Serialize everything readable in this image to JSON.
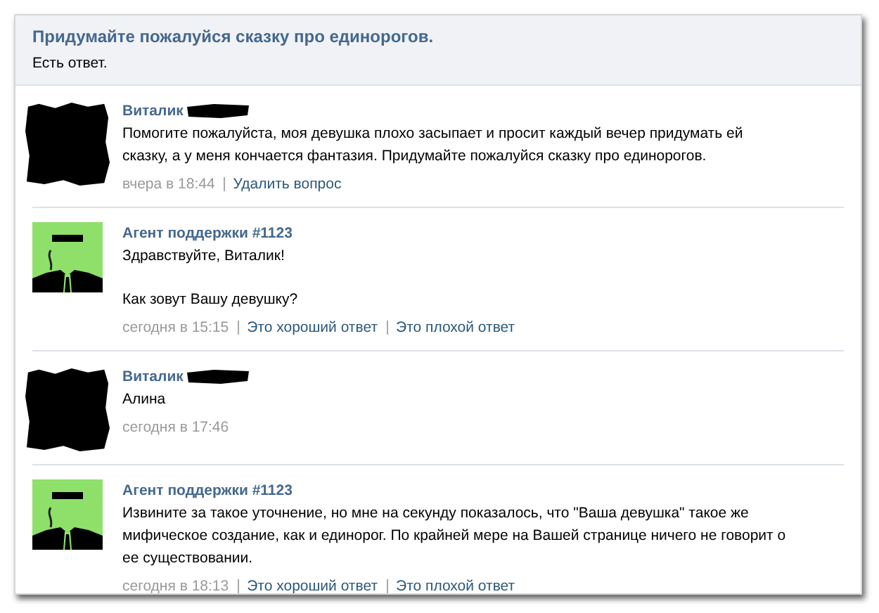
{
  "question": {
    "title": "Придумайте пожалуйся сказку про единорогов.",
    "status": "Есть ответ."
  },
  "messages": [
    {
      "kind": "user",
      "author": "Виталик",
      "paragraphs": [
        "Помогите пожалуйста, моя девушка плохо засыпает и просит каждый вечер придумать ей сказку, а у меня кончается фантазия. Придумайте пожалуйся сказку про единорогов."
      ],
      "time": "вчера в 18:44",
      "links": [
        "Удалить вопрос"
      ]
    },
    {
      "kind": "agent",
      "author": "Агент поддержки #1123",
      "paragraphs": [
        "Здравствуйте, Виталик!",
        "Как зовут Вашу девушку?"
      ],
      "time": "сегодня в 15:15",
      "links": [
        "Это хороший ответ",
        "Это плохой ответ"
      ]
    },
    {
      "kind": "user",
      "author": "Виталик",
      "paragraphs": [
        "Алина"
      ],
      "time": "сегодня в 17:46"
    },
    {
      "kind": "agent",
      "author": "Агент поддержки #1123",
      "paragraphs": [
        "Извините за такое уточнение, но мне на секунду показалось, что \"Ваша девушка\" такое же мифическое создание, как и единорог. По крайней мере на Вашей странице ничего не говорит о ее существовании."
      ],
      "time": "сегодня в 18:13",
      "links": [
        "Это хороший ответ",
        "Это плохой ответ"
      ]
    }
  ]
}
